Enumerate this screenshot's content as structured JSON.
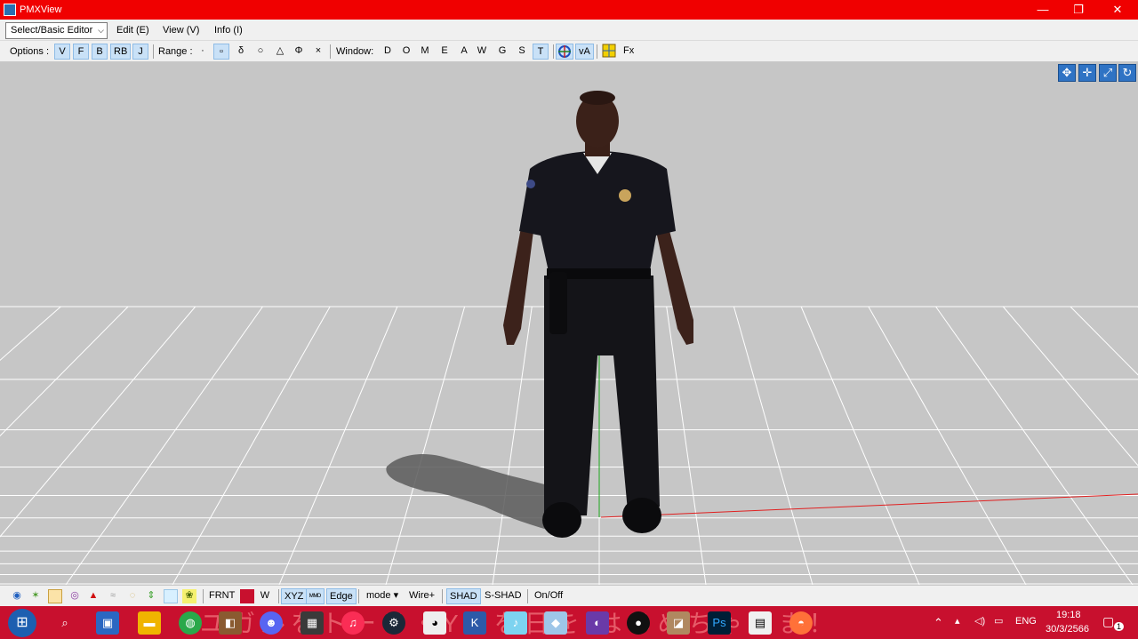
{
  "window": {
    "title": "PMXView",
    "minimize_glyph": "—",
    "restore_glyph": "❐",
    "close_glyph": "✕"
  },
  "menu": {
    "mode_select": "Select/Basic Editor",
    "items": [
      "Edit (E)",
      "View (V)",
      "Info (I)"
    ]
  },
  "toolbar": {
    "options_label": "Options :",
    "options": [
      "V",
      "F",
      "B",
      "RB",
      "J"
    ],
    "range_label": "Range :",
    "range": [
      "·",
      "▫",
      "δ",
      "○",
      "△",
      "Φ",
      "×"
    ],
    "window_label": "Window:",
    "window": [
      "D",
      "O",
      "M",
      "E",
      "A",
      "W",
      "G",
      "S",
      "T"
    ],
    "extra": [
      "vA",
      "Fx"
    ]
  },
  "viewport": {
    "background": "#c6c6c6",
    "grid_color": "#ffffff",
    "y_axis_color": "#1fa81f",
    "x_axis_color": "#e02020",
    "nav_icons": [
      "move-icon",
      "move-all-icon",
      "zoom-icon",
      "rotate-icon"
    ]
  },
  "bottombar": {
    "frnt": "FRNT",
    "w": "W",
    "xyz": "XYZ",
    "edge": "Edge",
    "mode": "mode",
    "wire": "Wire+",
    "shad": "SHAD",
    "sshad": "S-SHAD",
    "onoff": "On/Off"
  },
  "taskbar": {
    "wallpaper_text": "ユガルをトーリ・Y口を日を はじめちゃうま！",
    "lang": "ENG",
    "time": "19:18",
    "date": "30/3/2566",
    "notification_count": "1",
    "ps_label": "Ps"
  }
}
